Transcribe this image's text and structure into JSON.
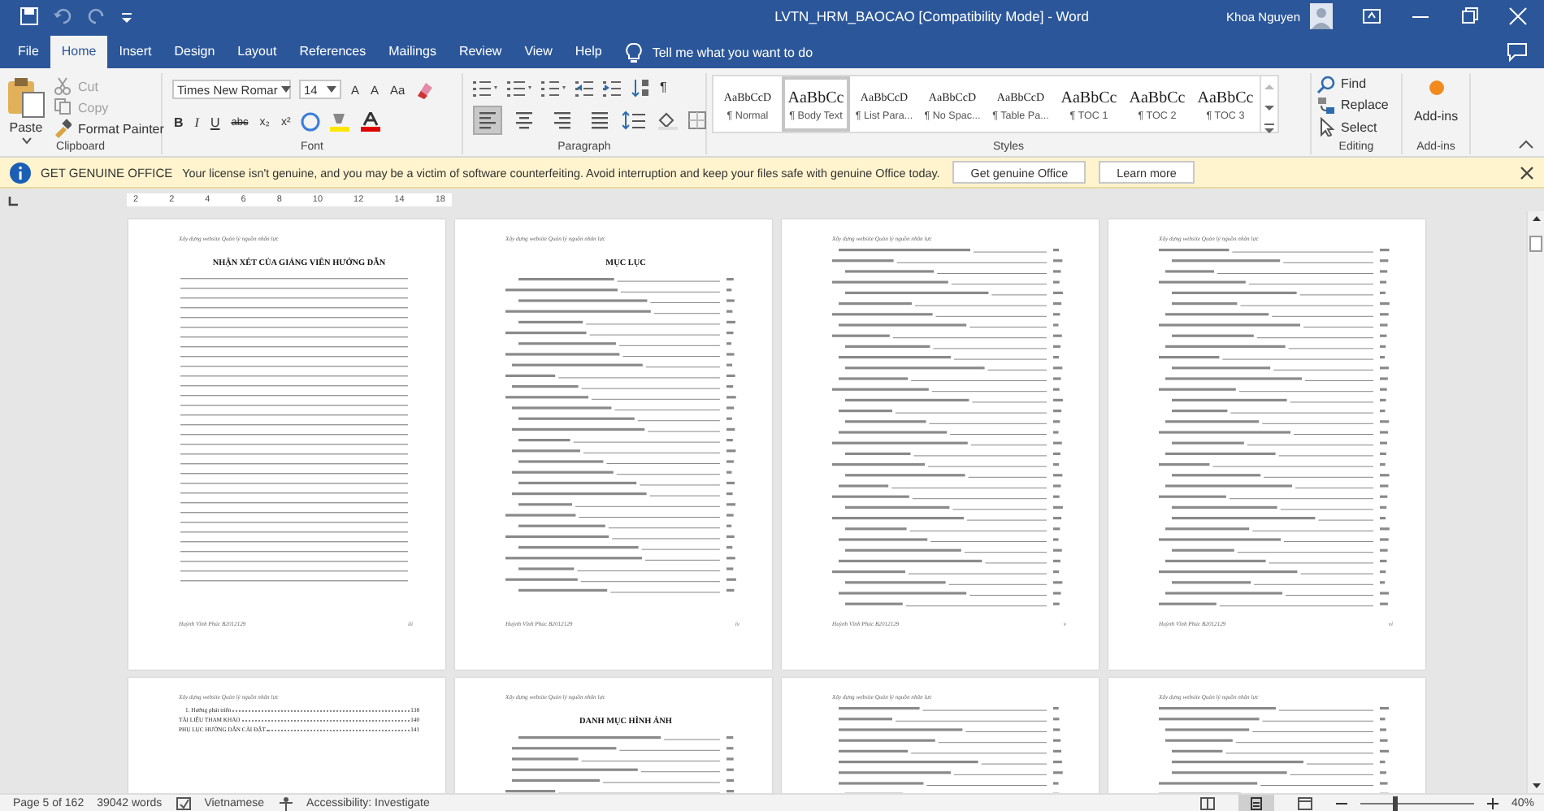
{
  "window": {
    "title": "LVTN_HRM_BAOCAO [Compatibility Mode]  -  Word",
    "user": "Khoa Nguyen"
  },
  "tabs": [
    {
      "label": "File",
      "selected": false
    },
    {
      "label": "Home",
      "selected": true
    },
    {
      "label": "Insert",
      "selected": false
    },
    {
      "label": "Design",
      "selected": false
    },
    {
      "label": "Layout",
      "selected": false
    },
    {
      "label": "References",
      "selected": false
    },
    {
      "label": "Mailings",
      "selected": false
    },
    {
      "label": "Review",
      "selected": false
    },
    {
      "label": "View",
      "selected": false
    },
    {
      "label": "Help",
      "selected": false
    }
  ],
  "tell_me": {
    "placeholder": "Tell me what you want to do"
  },
  "clipboard": {
    "label": "Clipboard",
    "paste": "Paste",
    "items": [
      {
        "kind": "cut",
        "label": "Cut",
        "disabled": true
      },
      {
        "kind": "copy",
        "label": "Copy",
        "disabled": true
      },
      {
        "kind": "painter",
        "label": "Format Painter",
        "disabled": false
      }
    ]
  },
  "font": {
    "label": "Font",
    "name": "Times New Romar",
    "size": "14",
    "sizers": [
      "A",
      "A",
      "Aa"
    ],
    "formats": [
      "B",
      "I",
      "U",
      "abc",
      "x₂",
      "x²"
    ]
  },
  "paragraph": {
    "label": "Paragraph",
    "marks": "¶",
    "alignments": [
      {
        "kind": "left",
        "selected": true
      },
      {
        "kind": "center",
        "selected": false
      },
      {
        "kind": "right",
        "selected": false
      },
      {
        "kind": "justify",
        "selected": false
      }
    ]
  },
  "styles": {
    "label": "Styles",
    "items": [
      {
        "preview": "AaBbCcD",
        "name": "¶ Normal",
        "selected": false,
        "kind": "serif"
      },
      {
        "preview": "AaBbCc",
        "name": "¶ Body Text",
        "selected": true,
        "kind": "large"
      },
      {
        "preview": "AaBbCcD",
        "name": "¶ List Para...",
        "selected": false,
        "kind": "serif"
      },
      {
        "preview": "AaBbCcD",
        "name": "¶ No Spac...",
        "selected": false,
        "kind": "serif"
      },
      {
        "preview": "AaBbCcD",
        "name": "¶ Table Pa...",
        "selected": false,
        "kind": "serif"
      },
      {
        "preview": "AaBbCc",
        "name": "¶ TOC 1",
        "selected": false,
        "kind": "large"
      },
      {
        "preview": "AaBbCc",
        "name": "¶ TOC 2",
        "selected": false,
        "kind": "large"
      },
      {
        "preview": "AaBbCc",
        "name": "¶ TOC 3",
        "selected": false,
        "kind": "large"
      }
    ]
  },
  "editing": {
    "label": "Editing",
    "items": [
      {
        "kind": "find",
        "label": "Find"
      },
      {
        "kind": "replace",
        "label": "Replace"
      },
      {
        "kind": "select",
        "label": "Select"
      }
    ]
  },
  "addins": {
    "label": "Add-ins",
    "button": "Add-ins"
  },
  "info_bar": {
    "title": "GET GENUINE OFFICE",
    "message": "Your license isn't genuine, and you may be a victim of software counterfeiting. Avoid interruption and keep your files safe with genuine Office today.",
    "buttons": [
      "Get genuine Office",
      "Learn more"
    ]
  },
  "ruler": {
    "marks": [
      "2",
      "2",
      "4",
      "6",
      "8",
      "10",
      "12",
      "14",
      "18"
    ]
  },
  "pages": [
    {
      "header": "Xây dựng website Quản lý nguồn nhân lực",
      "title": "NHẬN XÉT CỦA GIẢNG VIÊN HƯỚNG DẪN",
      "kind": "ruled",
      "footer": "Huỳnh Vĩnh Phúc B2012129",
      "number": "iii"
    },
    {
      "header": "Xây dựng website Quản lý nguồn nhân lực",
      "title": "MỤC LỤC",
      "kind": "toc",
      "footer": "Huỳnh Vĩnh Phúc B2012129",
      "number": "iv"
    },
    {
      "header": "Xây dựng website Quản lý nguồn nhân lực",
      "kind": "toc",
      "footer": "Huỳnh Vĩnh Phúc B2012129",
      "number": "v"
    },
    {
      "header": "Xây dựng website Quản lý nguồn nhân lực",
      "kind": "toc",
      "footer": "Huỳnh Vĩnh Phúc B2012129",
      "number": "vi"
    },
    {
      "header": "Xây dựng website Quản lý nguồn nhân lực",
      "kind": "entries",
      "entries": [
        {
          "text": "1. Hướng phát triển",
          "page": "138"
        },
        {
          "text": "TÀI LIỆU THAM KHẢO",
          "page": "140"
        },
        {
          "text": "PHỤ LỤC HƯỚNG DẪN CÀI ĐẶT",
          "page": "141"
        }
      ]
    },
    {
      "header": "Xây dựng website Quản lý nguồn nhân lực",
      "title": "DANH MỤC HÌNH ẢNH",
      "kind": "toc"
    },
    {
      "header": "Xây dựng website Quản lý nguồn nhân lực",
      "kind": "toc"
    },
    {
      "header": "Xây dựng website Quản lý nguồn nhân lực",
      "kind": "toc"
    }
  ],
  "status_bar": {
    "page": "Page 5 of 162",
    "words": "39042 words",
    "language": "Vietnamese",
    "accessibility": "Accessibility: Investigate",
    "views": [
      {
        "kind": "read",
        "selected": false
      },
      {
        "kind": "print",
        "selected": true
      },
      {
        "kind": "web",
        "selected": false
      }
    ],
    "zoom": {
      "level": 0.3,
      "reading": "40%"
    }
  }
}
